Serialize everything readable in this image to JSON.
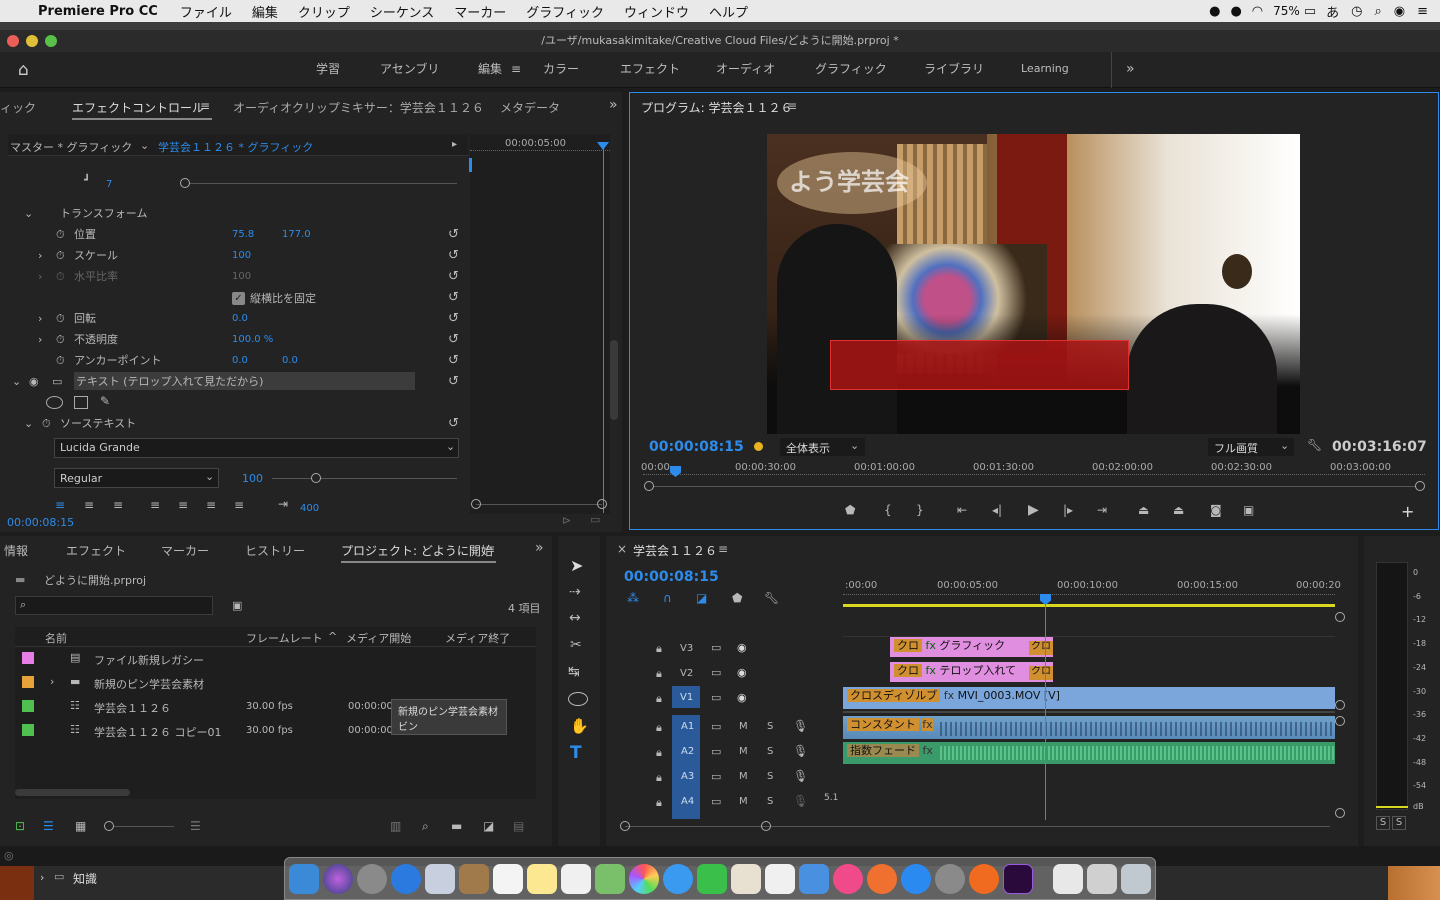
{
  "menubar": {
    "app": "Premiere Pro CC",
    "items": [
      "ファイル",
      "編集",
      "クリップ",
      "シーケンス",
      "マーカー",
      "グラフィック",
      "ウィンドウ",
      "ヘルプ"
    ],
    "battery": "75%",
    "ime": "あ"
  },
  "window": {
    "title": "/ユーザ/mukasakimitake/Creative Cloud Files/どように開始.prproj *"
  },
  "workspaces": [
    "学習",
    "アセンブリ",
    "編集",
    "カラー",
    "エフェクト",
    "オーディオ",
    "グラフィック",
    "ライブラリ",
    "Learning"
  ],
  "effects": {
    "tab_left": "ィック",
    "tab_active": "エフェクトコントロール",
    "tab_mixer": "オーディオクリップミキサー：学芸会１１２６",
    "tab_meta": "メタデータ",
    "master": "マスター * グラフィック",
    "clip": "学芸会１１２６ * グラフィック",
    "ruler_time": "00:00:05:00",
    "prev_value": "7",
    "transform": "トランスフォーム",
    "position_label": "位置",
    "position_x": "75.8",
    "position_y": "177.0",
    "scale_label": "スケール",
    "scale_value": "100",
    "hscale_label": "水平比率",
    "hscale_value": "100",
    "uniform_label": "縦横比を固定",
    "rotation_label": "回転",
    "rotation_value": "0.0",
    "opacity_label": "不透明度",
    "opacity_value": "100.0 %",
    "anchor_label": "アンカーポイント",
    "anchor_x": "0.0",
    "anchor_y": "0.0",
    "text_layer": "テキスト (テロップ入れて見ただから)",
    "source_text": "ソーステキスト",
    "font": "Lucida Grande",
    "style": "Regular",
    "size": "100",
    "tracking": "400",
    "timecode": "00:00:08:15"
  },
  "program": {
    "title": "プログラム: 学芸会１１２６",
    "timecode": "00:00:08:15",
    "fit": "全体表示",
    "quality": "フル画質",
    "duration": "00:03:16:07",
    "ruler": [
      "00:00",
      "00:00:30:00",
      "00:01:00:00",
      "00:01:30:00",
      "00:02:00:00",
      "00:02:30:00",
      "00:03:00:00"
    ],
    "overlay_title": "よう学芸会"
  },
  "project": {
    "tabs": [
      "情報",
      "エフェクト",
      "マーカー",
      "ヒストリー",
      "プロジェクト: どように開始"
    ],
    "file": "どように開始.prproj",
    "count": "4 項目",
    "columns": [
      "名前",
      "フレームレート",
      "メディア開始",
      "メディア終了"
    ],
    "rows": [
      {
        "name": "ファイル新規レガシー",
        "fps": "",
        "start": "",
        "color": "#e67ee6"
      },
      {
        "name": "新規のピン学芸会素材",
        "fps": "",
        "start": "",
        "color": "#e8a23a"
      },
      {
        "name": "学芸会１１２６",
        "fps": "30.00 fps",
        "start": "00:00:00:",
        "color": "#50c050"
      },
      {
        "name": "学芸会１１２６ コピー01",
        "fps": "30.00 fps",
        "start": "00:00:00:",
        "color": "#50c050"
      }
    ],
    "tooltip_line1": "新規のピン学芸会素材",
    "tooltip_line2": "ビン"
  },
  "timeline": {
    "title": "学芸会１１２６",
    "timecode": "00:00:08:15",
    "ruler": [
      ":00:00",
      "00:00:05:00",
      "00:00:10:00",
      "00:00:15:00",
      "00:00:20"
    ],
    "tracks": [
      "V3",
      "V2",
      "V1",
      "A1",
      "A2",
      "A3",
      "A4"
    ],
    "clip_v3_a": "クロ",
    "clip_v3": "グラフィック",
    "clip_v3_b": "クロ",
    "clip_v2_a": "クロ",
    "clip_v2": "テロップ入れて",
    "clip_v2_b": "クロ",
    "clip_v1_t": "クロスディゾルブ",
    "clip_v1": "MVI_0003.MOV [V]",
    "clip_a1": "コンスタント",
    "clip_a2": "指数フェード",
    "a4_label": "5.1",
    "ms": [
      "M",
      "S"
    ]
  },
  "meter": {
    "scale": [
      "0",
      "-6",
      "-12",
      "-18",
      "-24",
      "-30",
      "-36",
      "-42",
      "-48",
      "-54",
      "dB"
    ],
    "solo": [
      "S",
      "S"
    ]
  },
  "finder": {
    "item": "知識"
  }
}
